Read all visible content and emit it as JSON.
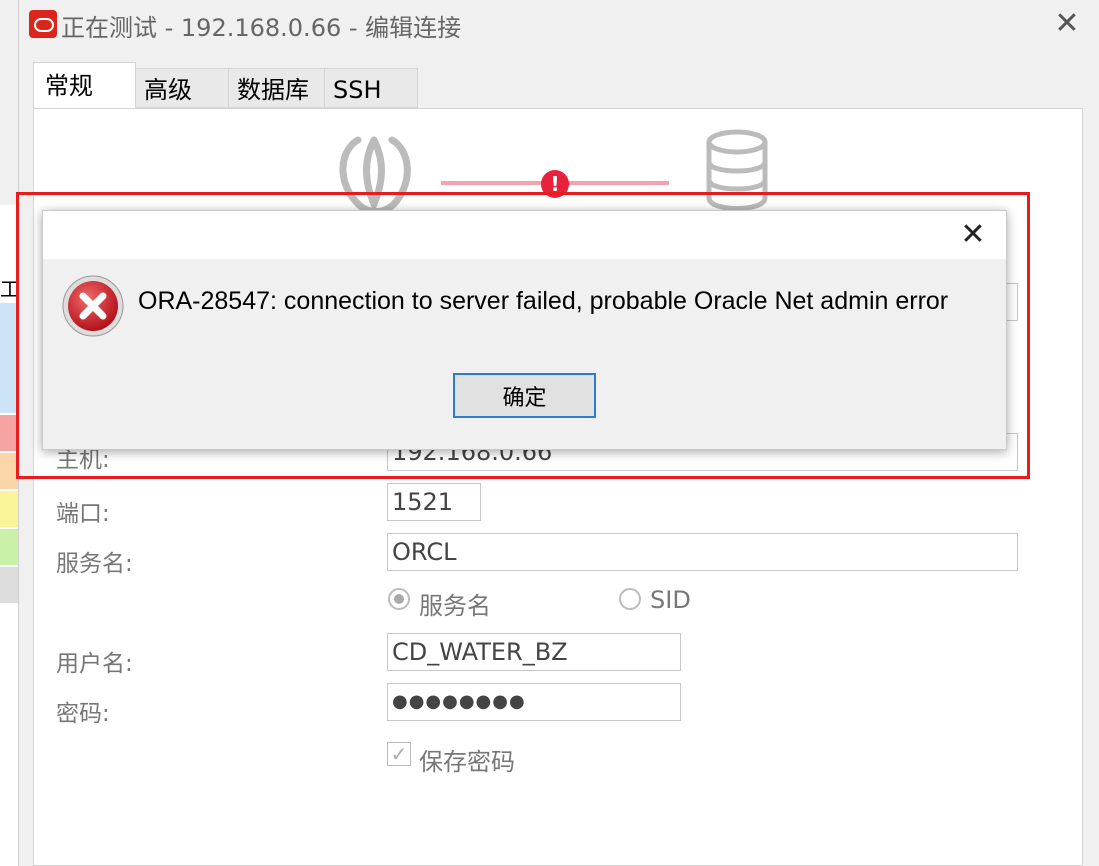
{
  "window": {
    "title": "正在测试 - 192.168.0.66 - 编辑连接"
  },
  "tabs": [
    {
      "label": "常规"
    },
    {
      "label": "高级"
    },
    {
      "label": "数据库"
    },
    {
      "label": "SSH"
    }
  ],
  "form": {
    "host_label": "主机:",
    "host_value": "192.168.0.66",
    "port_label": "端口:",
    "port_value": "1521",
    "service_label": "服务名:",
    "service_value": "ORCL",
    "radio_service": "服务名",
    "radio_sid": "SID",
    "user_label": "用户名:",
    "user_value": "CD_WATER_BZ",
    "password_label": "密码:",
    "password_value": "●●●●●●●●",
    "save_password": "保存密码"
  },
  "dialog": {
    "message": "ORA-28547: connection to server failed, probable Oracle Net admin error",
    "ok_label": "确定"
  },
  "behind": {
    "glyph": "工"
  },
  "colors": {
    "highlight": "#e81c1c",
    "error": "#e8213d",
    "ok_border": "#2e7ad2"
  },
  "icons": [
    "navicat-icon",
    "database-icon",
    "error-icon",
    "close-icon"
  ]
}
